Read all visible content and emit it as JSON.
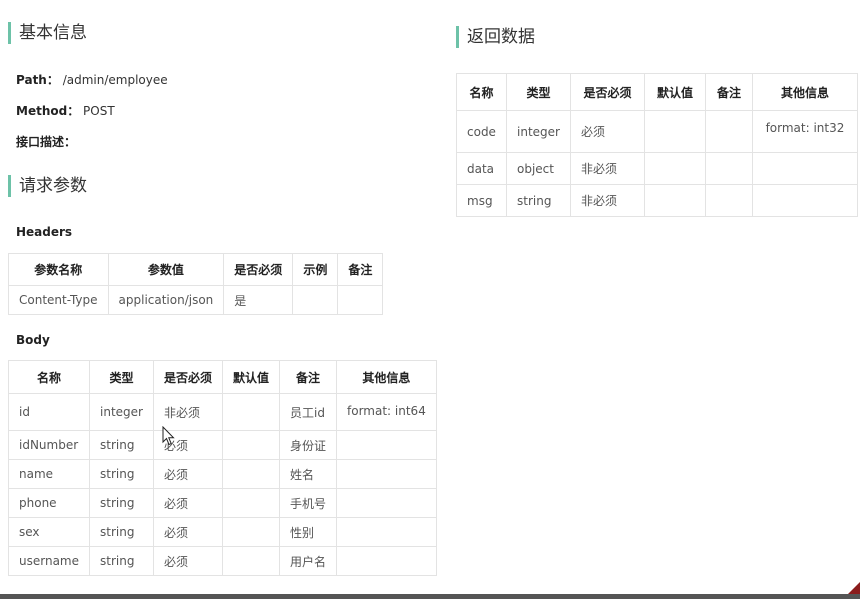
{
  "basic": {
    "title": "基本信息",
    "path_label": "Path：",
    "path_value": "/admin/employee",
    "method_label": "Method：",
    "method_value": "POST",
    "desc_label": "接口描述："
  },
  "request": {
    "title": "请求参数",
    "headers_label": "Headers",
    "headers_columns": [
      "参数名称",
      "参数值",
      "是否必须",
      "示例",
      "备注"
    ],
    "headers_rows": [
      [
        "Content-Type",
        "application/json",
        "是",
        "",
        ""
      ]
    ],
    "body_label": "Body",
    "body_columns": [
      "名称",
      "类型",
      "是否必须",
      "默认值",
      "备注",
      "其他信息"
    ],
    "body_rows": [
      [
        "id",
        "integer",
        "非必须",
        "",
        "员工id",
        "format: int64"
      ],
      [
        "idNumber",
        "string",
        "必须",
        "",
        "身份证",
        ""
      ],
      [
        "name",
        "string",
        "必须",
        "",
        "姓名",
        ""
      ],
      [
        "phone",
        "string",
        "必须",
        "",
        "手机号",
        ""
      ],
      [
        "sex",
        "string",
        "必须",
        "",
        "性别",
        ""
      ],
      [
        "username",
        "string",
        "必须",
        "",
        "用户名",
        ""
      ]
    ]
  },
  "response": {
    "title": "返回数据",
    "columns": [
      "名称",
      "类型",
      "是否必须",
      "默认值",
      "备注",
      "其他信息"
    ],
    "rows": [
      [
        "code",
        "integer",
        "必须",
        "",
        "",
        "format: int32"
      ],
      [
        "data",
        "object",
        "非必须",
        "",
        "",
        ""
      ],
      [
        "msg",
        "string",
        "非必须",
        "",
        "",
        ""
      ]
    ]
  }
}
